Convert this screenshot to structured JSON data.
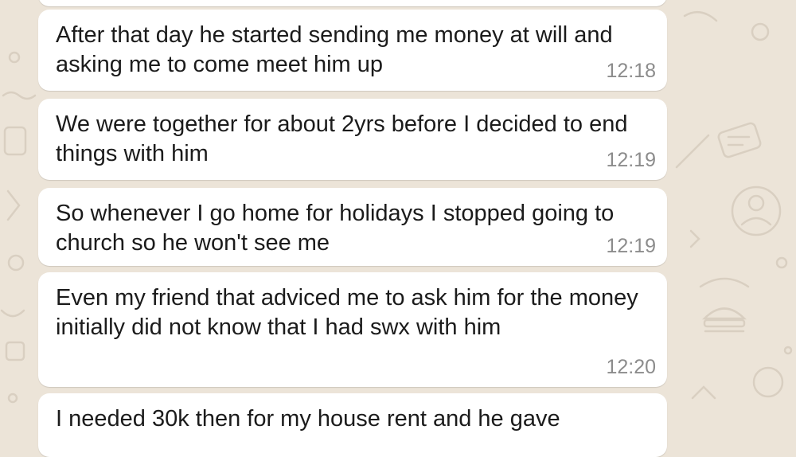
{
  "messages": [
    {
      "text": "After that day he started sending me money at will and asking me to come meet him up",
      "time": "12:18"
    },
    {
      "text": "We were together for about 2yrs before I decided to end things with him",
      "time": "12:19"
    },
    {
      "text": "So whenever I go home for holidays I stopped going to church so he won't see me",
      "time": "12:19"
    },
    {
      "text": "Even my friend that adviced me to ask him for the money initially did not know that I had swx with him",
      "time": "12:20"
    },
    {
      "text": "I needed 30k then for my house rent and he gave",
      "time": ""
    }
  ],
  "colors": {
    "wallpaper": "#ece4d8",
    "bubble": "#ffffff",
    "text": "#1b1b1b",
    "timestamp": "#8c8c8c"
  }
}
